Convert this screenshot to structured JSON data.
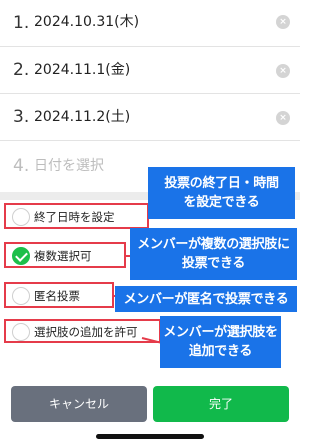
{
  "dates": [
    {
      "num": "1.",
      "value": "2024.10.31(木)"
    },
    {
      "num": "2.",
      "value": "2024.11.1(金)"
    },
    {
      "num": "3.",
      "value": "2024.11.2(土)"
    },
    {
      "num": "4.",
      "value": "日付を選択"
    }
  ],
  "clear_glyph": "×",
  "options": [
    {
      "label": "終了日時を設定",
      "checked": false
    },
    {
      "label": "複数選択可",
      "checked": true
    },
    {
      "label": "匿名投票",
      "checked": false
    },
    {
      "label": "選択肢の追加を許可",
      "checked": false
    }
  ],
  "callouts": [
    {
      "line1": "投票の終了日・時間",
      "line2": "を設定できる"
    },
    {
      "line1": "メンバーが複数の選択肢に",
      "line2": "投票できる"
    },
    {
      "line1": "メンバーが匿名で投票できる"
    },
    {
      "line1": "メンバーが選択肢を",
      "line2": "追加できる"
    }
  ],
  "buttons": {
    "cancel": "キャンセル",
    "done": "完了"
  },
  "colors": {
    "accent_green": "#11b94b",
    "highlight_red": "#e53b4a",
    "callout_blue": "#1a73e8",
    "cancel_gray": "#69707d"
  }
}
